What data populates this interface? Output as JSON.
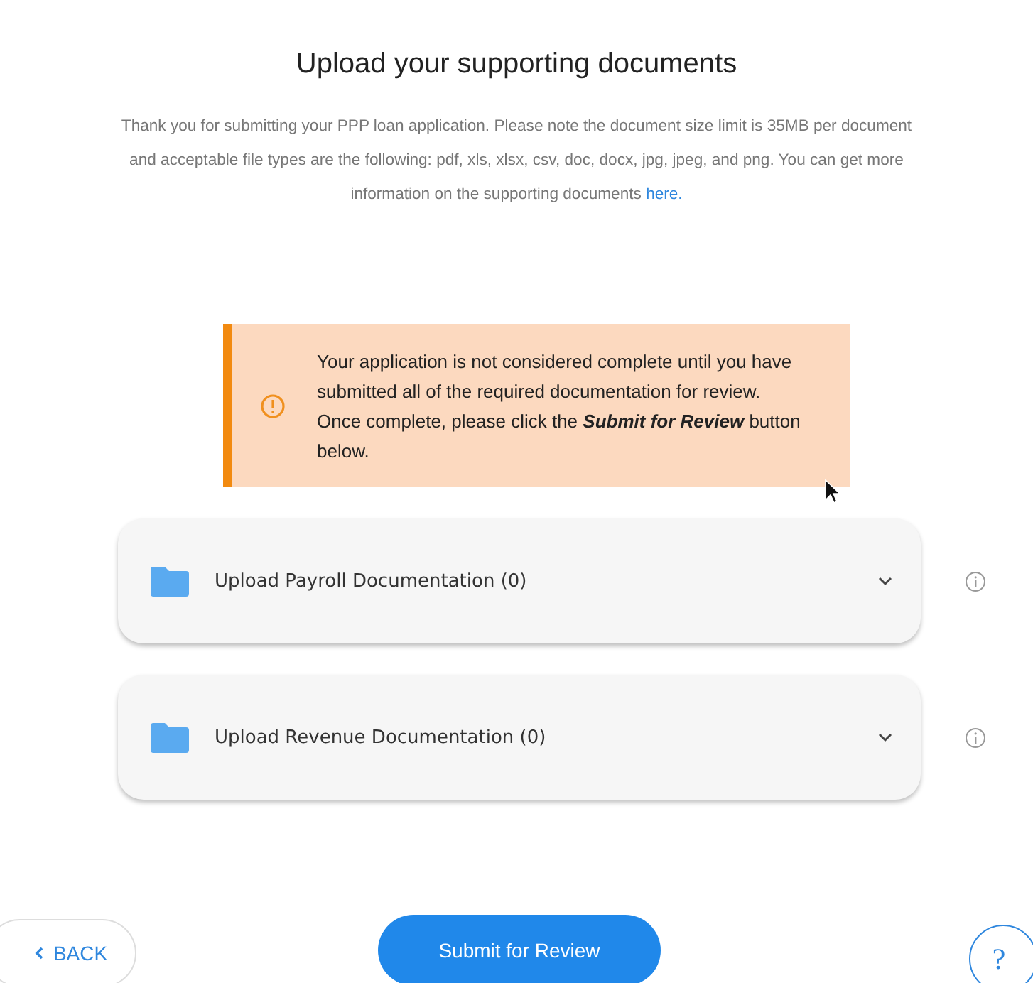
{
  "title": "Upload your supporting documents",
  "intro": {
    "text": "Thank you for submitting your PPP loan application. Please note the document size limit is 35MB per document and acceptable file types are the following: pdf, xls, xlsx, csv, doc, docx, jpg, jpeg, and png. You can get more information on the supporting documents",
    "link": "here."
  },
  "alert": {
    "text": "Your application is not considered complete until you have submitted all of the required documentation for review. Once complete, please click the **Submit for Review** button below."
  },
  "sections": [
    {
      "label": "Upload Payroll Documentation (0)",
      "expanded": false
    },
    {
      "label": "Upload Revenue Documentation (0)",
      "expanded": false
    }
  ],
  "back_button": "BACK",
  "submit_button": "Submit for Review",
  "help_button": "?"
}
